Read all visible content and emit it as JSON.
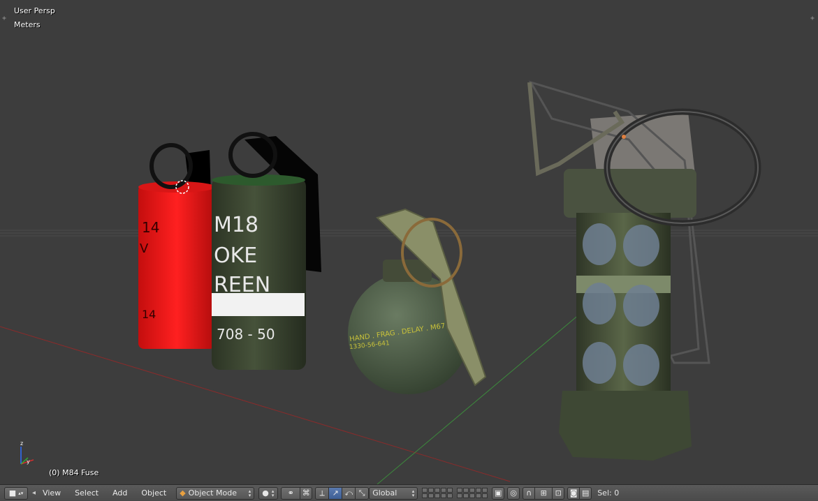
{
  "viewport": {
    "view_name": "User Persp",
    "units": "Meters",
    "active_object": "(0) M84 Fuse"
  },
  "scene_labels": {
    "red_grenade_top": "14",
    "red_grenade_mid": "V",
    "red_grenade_bottom": "14",
    "smoke_line1": "M18",
    "smoke_line2": "OKE",
    "smoke_line3": "REEN",
    "smoke_code": "708 - 50",
    "frag_text": "HAND . FRAG . DELAY . M67",
    "frag_code": "1330-56-641"
  },
  "header": {
    "menus": [
      "View",
      "Select",
      "Add",
      "Object"
    ],
    "mode": "Object Mode",
    "orientation": "Global",
    "status": "Sel: 0"
  },
  "colors": {
    "viewport_bg": "#3d3d3d",
    "grid": "#4a4a4a",
    "x_axis": "#8a2b2b",
    "y_axis": "#3c8a3c",
    "header_bg": "#505050",
    "red_grenade": "#e01414",
    "olive": "#3b4630",
    "frag_green": "#4a5a44"
  }
}
